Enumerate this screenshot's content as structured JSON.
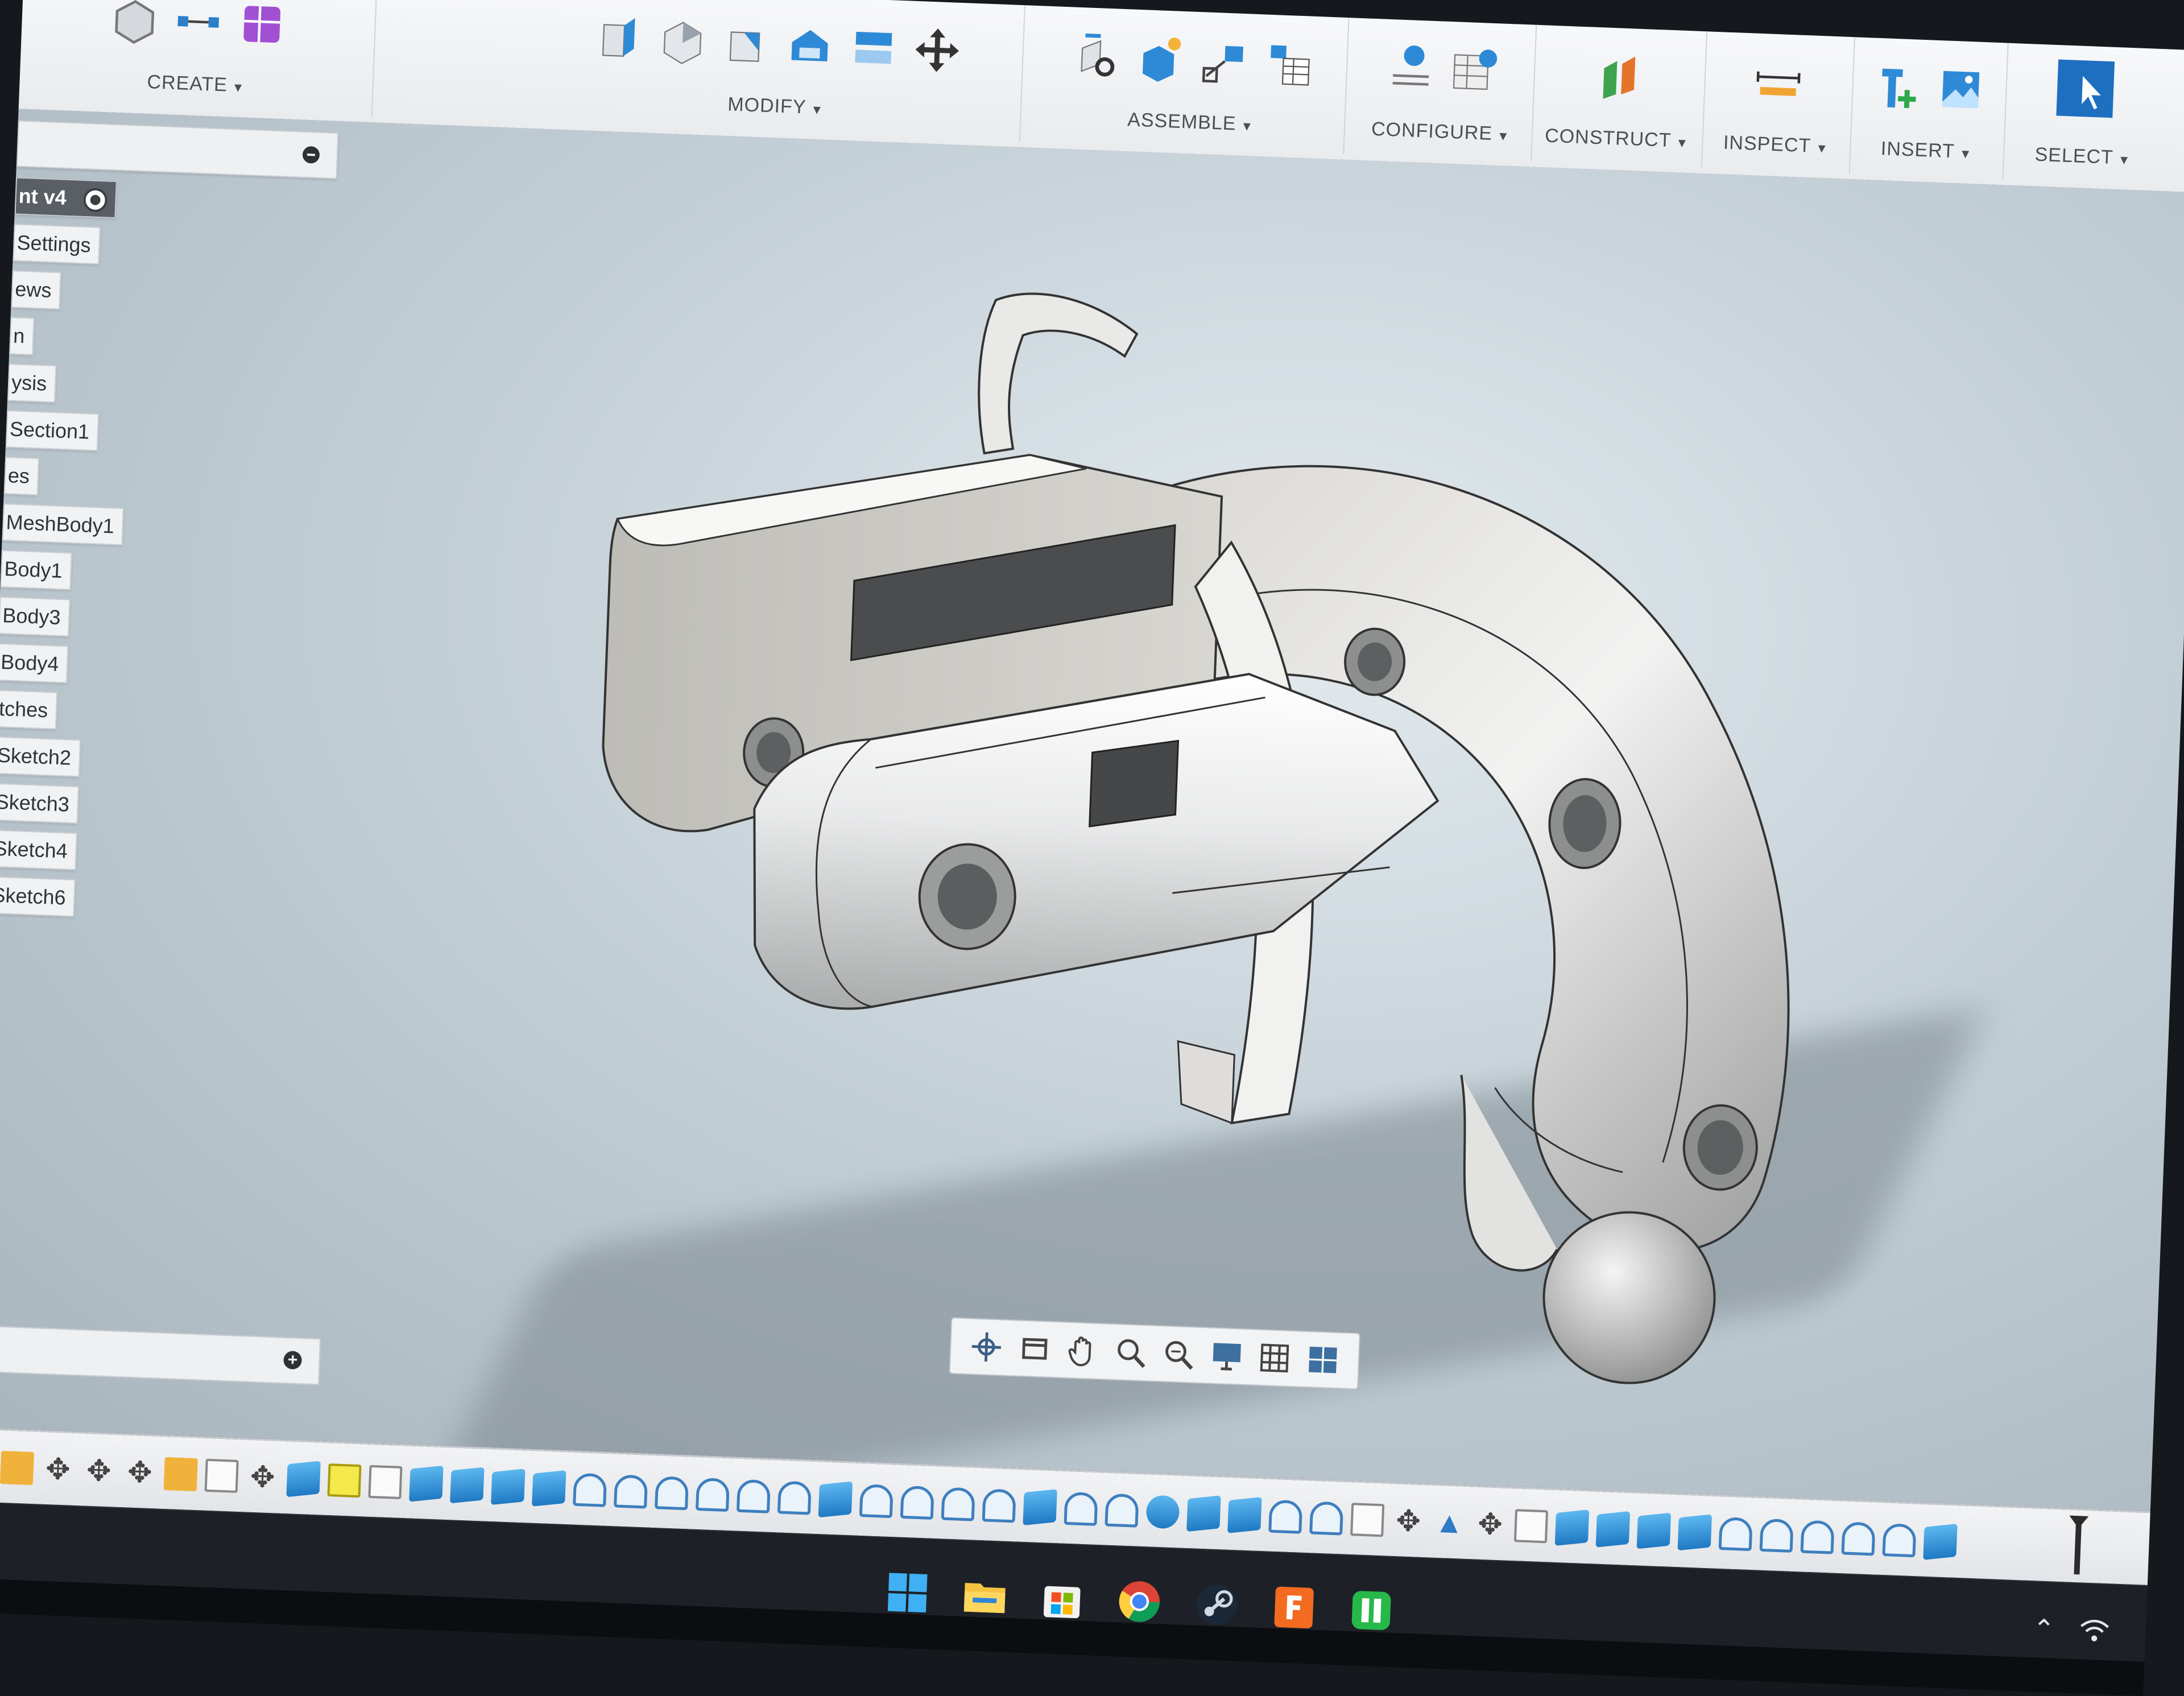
{
  "toolbar": {
    "groups": [
      {
        "label": "CREATE"
      },
      {
        "label": "MODIFY"
      },
      {
        "label": "ASSEMBLE"
      },
      {
        "label": "CONFIGURE"
      },
      {
        "label": "CONSTRUCT"
      },
      {
        "label": "INSPECT"
      },
      {
        "label": "INSERT"
      },
      {
        "label": "SELECT"
      }
    ]
  },
  "browser": {
    "root_label": "nt v4",
    "items": [
      {
        "label": "Settings"
      },
      {
        "label": "ews"
      },
      {
        "label": "n"
      },
      {
        "label": "ysis"
      },
      {
        "label": "Section1"
      },
      {
        "label": "es"
      },
      {
        "label": "MeshBody1"
      },
      {
        "label": "Body1"
      },
      {
        "label": "Body3"
      },
      {
        "label": "Body4"
      },
      {
        "label": "tches"
      },
      {
        "label": "Sketch2"
      },
      {
        "label": "Sketch3"
      },
      {
        "label": "Sketch4"
      },
      {
        "label": "Sketch6"
      }
    ]
  },
  "navbar": {
    "icons": [
      "orbit-icon",
      "look-at-icon",
      "pan-icon",
      "zoom-icon",
      "fit-icon",
      "display-settings-icon",
      "grid-icon",
      "viewports-icon"
    ]
  },
  "colors": {
    "accent": "#1f79c4",
    "viewport_bg": "#c4d0d7",
    "taskbar": "#1d2026"
  },
  "taskbar": {
    "apps": [
      "windows-start-icon",
      "file-explorer-icon",
      "microsoft-store-icon",
      "chrome-icon",
      "steam-icon",
      "fusion-360-icon",
      "green-app-icon"
    ]
  }
}
